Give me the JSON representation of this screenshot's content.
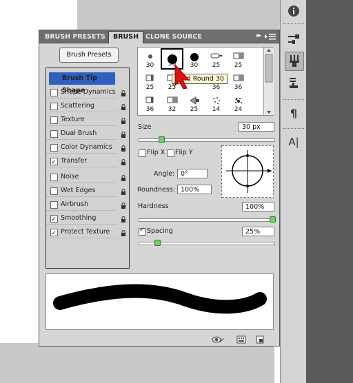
{
  "tabs": [
    {
      "label": "BRUSH PRESETS",
      "active": false
    },
    {
      "label": "BRUSH",
      "active": true
    },
    {
      "label": "CLONE SOURCE",
      "active": false
    }
  ],
  "panel_menu_arrows": "▸▸",
  "brush_presets_button": "Brush Presets",
  "options": [
    {
      "label": "Brush Tip Shape",
      "checkbox": false,
      "checked": false,
      "selected": true,
      "lock": false
    },
    {
      "label": "Shape Dynamics",
      "checkbox": true,
      "checked": false,
      "selected": false,
      "lock": true
    },
    {
      "label": "Scattering",
      "checkbox": true,
      "checked": false,
      "selected": false,
      "lock": true
    },
    {
      "label": "Texture",
      "checkbox": true,
      "checked": false,
      "selected": false,
      "lock": true
    },
    {
      "label": "Dual Brush",
      "checkbox": true,
      "checked": false,
      "selected": false,
      "lock": true
    },
    {
      "label": "Color Dynamics",
      "checkbox": true,
      "checked": false,
      "selected": false,
      "lock": true
    },
    {
      "label": "Transfer",
      "checkbox": true,
      "checked": true,
      "selected": false,
      "lock": true
    },
    {
      "label": "Noise",
      "checkbox": true,
      "checked": false,
      "selected": false,
      "lock": true
    },
    {
      "label": "Wet Edges",
      "checkbox": true,
      "checked": false,
      "selected": false,
      "lock": true
    },
    {
      "label": "Airbrush",
      "checkbox": true,
      "checked": false,
      "selected": false,
      "lock": true
    },
    {
      "label": "Smoothing",
      "checkbox": true,
      "checked": true,
      "selected": false,
      "lock": true
    },
    {
      "label": "Protect Texture",
      "checkbox": true,
      "checked": true,
      "selected": false,
      "lock": true
    }
  ],
  "brush_grid": [
    [
      {
        "size": "30",
        "tip": "soft-dot"
      },
      {
        "size": "30",
        "tip": "hard-dot-large",
        "selected": true
      },
      {
        "size": "30",
        "tip": "hard-dot"
      },
      {
        "size": "25",
        "tip": "bristle-flat"
      },
      {
        "size": "25",
        "tip": "bristle-wide"
      }
    ],
    [
      {
        "size": "25",
        "tip": "bristle-side"
      },
      {
        "size": "25",
        "tip": "bristle-wide"
      },
      {
        "size": "",
        "tip": "hidden"
      },
      {
        "size": "36",
        "tip": "bristle-round"
      },
      {
        "size": "36",
        "tip": "bristle-wide"
      }
    ],
    [
      {
        "size": "36",
        "tip": "bristle-side"
      },
      {
        "size": "32",
        "tip": "bristle-wide"
      },
      {
        "size": "25",
        "tip": "bristle-fan"
      },
      {
        "size": "14",
        "tip": "spray"
      },
      {
        "size": "24",
        "tip": "spatter"
      }
    ]
  ],
  "tooltip": "Hard Round 30",
  "size": {
    "label": "Size",
    "value": "30 px",
    "slider_fraction": 0.15
  },
  "flip_x": {
    "label": "Flip X",
    "checked": false
  },
  "flip_y": {
    "label": "Flip Y",
    "checked": false
  },
  "angle": {
    "label": "Angle:",
    "value": "0°"
  },
  "roundness": {
    "label": "Roundness:",
    "value": "100%"
  },
  "hardness": {
    "label": "Hardness",
    "value": "100%",
    "slider_fraction": 1.0
  },
  "spacing": {
    "label": "Spacing",
    "value": "25%",
    "checked": true,
    "slider_fraction": 0.12
  },
  "dock_icons": [
    "info-icon",
    "brush-settings-icon",
    "brush-icon",
    "clone-stamp-icon",
    "paragraph-icon",
    "character-icon"
  ],
  "colors": {
    "selected_blue": "#2f5fbf",
    "knob_green": "#6fcf6f",
    "cursor_red": "#e01010"
  }
}
